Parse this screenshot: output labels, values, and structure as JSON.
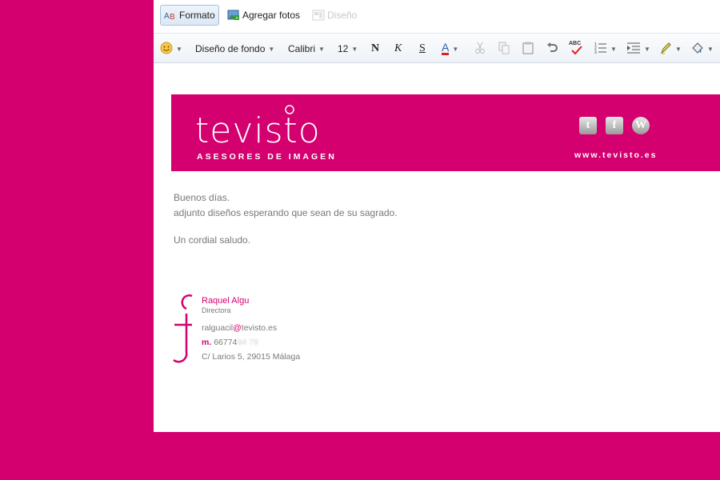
{
  "toolbar": {
    "format_label": "Formato",
    "add_photos_label": "Agregar fotos",
    "design_label": "Diseño"
  },
  "format_bar": {
    "background_label": "Diseño de fondo",
    "font_name": "Calibri",
    "font_size": "12",
    "bold": "N",
    "italic": "K",
    "underline": "S",
    "font_color_letter": "A",
    "spell_label": "ABC"
  },
  "banner": {
    "brand_name": "tevisto",
    "brand_subtitle": "ASESORES DE IMAGEN",
    "url": "www.tevisto.es",
    "social_icons": [
      "twitter-icon",
      "facebook-icon",
      "wordpress-icon"
    ]
  },
  "message": {
    "greeting": "Buenos días.",
    "line1": "adjunto diseños esperando que sean de su sagrado.",
    "closing": "Un cordial saludo."
  },
  "signature": {
    "name": "Raquel Algu",
    "title": "Directora",
    "email_user": "ralguacil",
    "email_at": "@",
    "email_domain": "tevisto.es",
    "phone_prefix": "m.",
    "phone_visible": "66774",
    "phone_blurred": "94 79",
    "address": "C/ Larios 5, 29015 Málaga"
  },
  "colors": {
    "brand": "#d4006f",
    "text": "#777777"
  }
}
